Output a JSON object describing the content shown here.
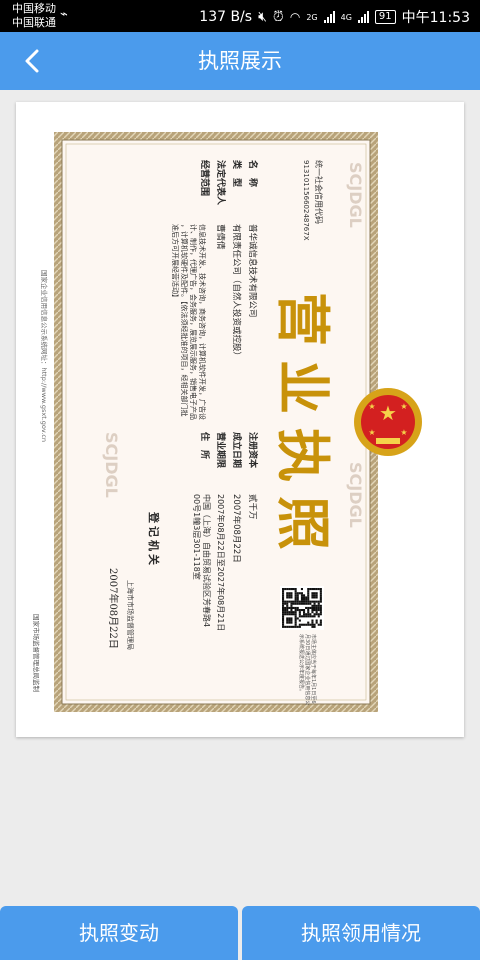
{
  "status_bar": {
    "carrier_1": "中国移动",
    "carrier_2": "中国联通",
    "speed": "137 B/s",
    "network_2g": "2G",
    "network_4g": "4G",
    "battery": "91",
    "time": "中午11:53"
  },
  "header": {
    "title": "执照展示"
  },
  "license": {
    "main_title": "营业执照",
    "credit_code_label": "统一社会信用代码",
    "credit_code": "91310115660248767X",
    "name_label": "名　称",
    "name_value": "普华诚信息技术有限公司",
    "type_label": "类　型",
    "type_value": "有限责任公司（自然人投资或控股）",
    "rep_label": "法定代表人",
    "rep_value": "曹倩倩",
    "scope_label": "经营范围",
    "scope_value": "信息技术开发、技术咨询，商务咨询，计算机软件开发，广告设计、制作，代理广告，会务服务，展览展示服务，销售电子产品，计算机软硬件及配件。【依法须经批准的项目，经相关部门批准后方可开展经营活动】",
    "capital_label": "注册资本",
    "capital_value": "贰千万",
    "est_label": "成立日期",
    "est_value": "2007年08月22日",
    "term_label": "营业期限",
    "term_value": "2007年08月22日至2027年08月21日",
    "addr_label": "住　所",
    "addr_value": "中国（上海）自由贸易试验区芳春路400号1幢3层301-118室",
    "authority_label": "登记机关",
    "authority_name": "上海市市场监督管理局",
    "issue_date": "2007年08月22日",
    "side_left": "国家企业信用信息公示系统网址：http://www.gsxt.gov.cn",
    "side_right": "国家市场监督管理总局监制",
    "qr_note": "市场主体应当于每年1月1日至6月30日通过国家企业信用信息公示系统报送公示年度报告。",
    "watermark": "SCJDGL"
  },
  "buttons": {
    "change": "执照变动",
    "usage": "执照领用情况"
  },
  "colors": {
    "accent": "#4b9bec",
    "border_gold": "#b8a37a",
    "title_gold": "#c8920a",
    "emblem_red": "#d32020"
  },
  "icons": {
    "back": "chevron-left-icon",
    "usb": "usb-icon",
    "alarm": "alarm-icon",
    "wifi": "wifi-icon",
    "mute": "mute-icon",
    "emblem": "national-emblem-icon",
    "qr": "qr-code-icon"
  }
}
